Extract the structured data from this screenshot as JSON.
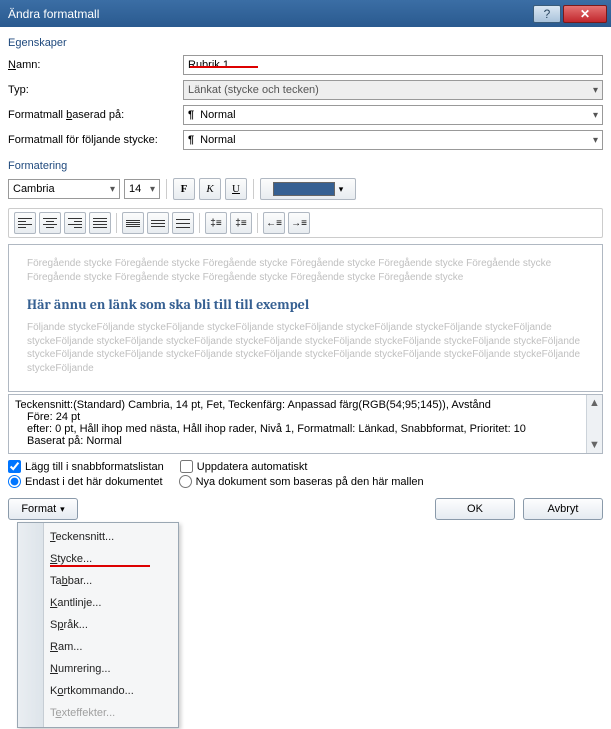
{
  "titlebar": {
    "title": "Ändra formatmall"
  },
  "section_props": "Egenskaper",
  "labels": {
    "name": "Namn:",
    "type": "Typ:",
    "based_on": "Formatmall baserad på:",
    "next_style": "Formatmall för följande stycke:"
  },
  "values": {
    "name": "Rubrik 1",
    "type": "Länkat (stycke och tecken)",
    "based_on": "Normal",
    "next_style": "Normal"
  },
  "section_format": "Formatering",
  "fmt": {
    "font": "Cambria",
    "size": "14",
    "bold": "F",
    "italic": "K",
    "underline": "U",
    "auto": "Automatisk"
  },
  "preview": {
    "before": "Föregående stycke Föregående stycke Föregående stycke Föregående stycke Föregående stycke Föregående stycke Föregående stycke Föregående stycke Föregående stycke Föregående stycke Föregående stycke",
    "heading": "Här ännu en länk som ska bli till till exempel",
    "after": "Följande styckeFöljande styckeFöljande styckeFöljande styckeFöljande styckeFöljande styckeFöljande styckeFöljande styckeFöljande styckeFöljande styckeFöljande styckeFöljande styckeFöljande styckeFöljande styckeFöljande styckeFöljande styckeFöljande styckeFöljande styckeFöljande styckeFöljande styckeFöljande styckeFöljande styckeFöljande styckeFöljande styckeFöljande"
  },
  "info": {
    "line1": "Teckensnitt:(Standard) Cambria, 14 pt, Fet, Teckenfärg: Anpassad färg(RGB(54;95;145)), Avstånd",
    "line2": "Före:  24 pt",
    "line3": "efter:  0 pt, Håll ihop med nästa, Håll ihop rader, Nivå 1, Formatmall: Länkad, Snabbformat, Prioritet: 10",
    "line4": "Baserat på: Normal"
  },
  "checks": {
    "quicklist": "Lägg till i snabbformatslistan",
    "autoupdate": "Uppdatera automatiskt",
    "this_doc": "Endast i det här dokumentet",
    "new_docs": "Nya dokument som baseras på den här mallen"
  },
  "buttons": {
    "format": "Format",
    "ok": "OK",
    "cancel": "Avbryt"
  },
  "menu": {
    "font": "Teckensnitt...",
    "para": "Stycke...",
    "tabs": "Tabbar...",
    "border": "Kantlinje...",
    "lang": "Språk...",
    "frame": "Ram...",
    "numbering": "Numrering...",
    "shortcut": "Kortkommando...",
    "texteffects": "Texteffekter..."
  }
}
